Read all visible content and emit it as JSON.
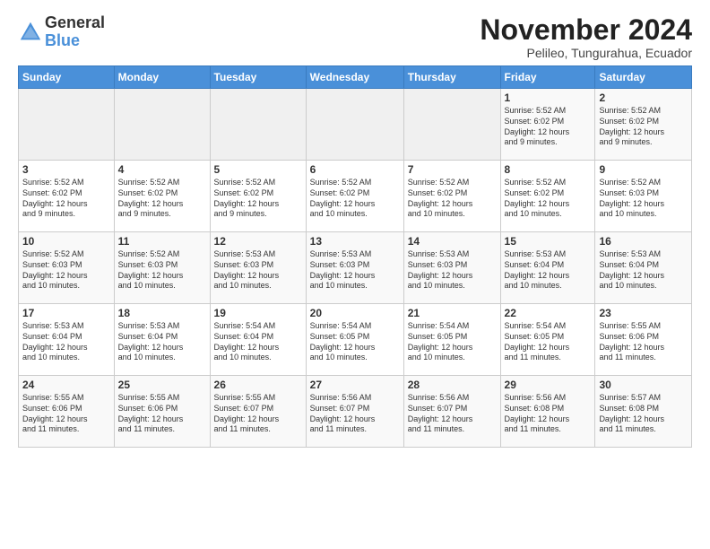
{
  "logo": {
    "general": "General",
    "blue": "Blue"
  },
  "title": "November 2024",
  "subtitle": "Pelileo, Tungurahua, Ecuador",
  "header": {
    "days": [
      "Sunday",
      "Monday",
      "Tuesday",
      "Wednesday",
      "Thursday",
      "Friday",
      "Saturday"
    ]
  },
  "weeks": [
    {
      "days": [
        {
          "num": "",
          "info": "",
          "empty": true
        },
        {
          "num": "",
          "info": "",
          "empty": true
        },
        {
          "num": "",
          "info": "",
          "empty": true
        },
        {
          "num": "",
          "info": "",
          "empty": true
        },
        {
          "num": "",
          "info": "",
          "empty": true
        },
        {
          "num": "1",
          "info": "Sunrise: 5:52 AM\nSunset: 6:02 PM\nDaylight: 12 hours\nand 9 minutes.",
          "empty": false
        },
        {
          "num": "2",
          "info": "Sunrise: 5:52 AM\nSunset: 6:02 PM\nDaylight: 12 hours\nand 9 minutes.",
          "empty": false
        }
      ]
    },
    {
      "days": [
        {
          "num": "3",
          "info": "Sunrise: 5:52 AM\nSunset: 6:02 PM\nDaylight: 12 hours\nand 9 minutes.",
          "empty": false
        },
        {
          "num": "4",
          "info": "Sunrise: 5:52 AM\nSunset: 6:02 PM\nDaylight: 12 hours\nand 9 minutes.",
          "empty": false
        },
        {
          "num": "5",
          "info": "Sunrise: 5:52 AM\nSunset: 6:02 PM\nDaylight: 12 hours\nand 9 minutes.",
          "empty": false
        },
        {
          "num": "6",
          "info": "Sunrise: 5:52 AM\nSunset: 6:02 PM\nDaylight: 12 hours\nand 10 minutes.",
          "empty": false
        },
        {
          "num": "7",
          "info": "Sunrise: 5:52 AM\nSunset: 6:02 PM\nDaylight: 12 hours\nand 10 minutes.",
          "empty": false
        },
        {
          "num": "8",
          "info": "Sunrise: 5:52 AM\nSunset: 6:02 PM\nDaylight: 12 hours\nand 10 minutes.",
          "empty": false
        },
        {
          "num": "9",
          "info": "Sunrise: 5:52 AM\nSunset: 6:03 PM\nDaylight: 12 hours\nand 10 minutes.",
          "empty": false
        }
      ]
    },
    {
      "days": [
        {
          "num": "10",
          "info": "Sunrise: 5:52 AM\nSunset: 6:03 PM\nDaylight: 12 hours\nand 10 minutes.",
          "empty": false
        },
        {
          "num": "11",
          "info": "Sunrise: 5:52 AM\nSunset: 6:03 PM\nDaylight: 12 hours\nand 10 minutes.",
          "empty": false
        },
        {
          "num": "12",
          "info": "Sunrise: 5:53 AM\nSunset: 6:03 PM\nDaylight: 12 hours\nand 10 minutes.",
          "empty": false
        },
        {
          "num": "13",
          "info": "Sunrise: 5:53 AM\nSunset: 6:03 PM\nDaylight: 12 hours\nand 10 minutes.",
          "empty": false
        },
        {
          "num": "14",
          "info": "Sunrise: 5:53 AM\nSunset: 6:03 PM\nDaylight: 12 hours\nand 10 minutes.",
          "empty": false
        },
        {
          "num": "15",
          "info": "Sunrise: 5:53 AM\nSunset: 6:04 PM\nDaylight: 12 hours\nand 10 minutes.",
          "empty": false
        },
        {
          "num": "16",
          "info": "Sunrise: 5:53 AM\nSunset: 6:04 PM\nDaylight: 12 hours\nand 10 minutes.",
          "empty": false
        }
      ]
    },
    {
      "days": [
        {
          "num": "17",
          "info": "Sunrise: 5:53 AM\nSunset: 6:04 PM\nDaylight: 12 hours\nand 10 minutes.",
          "empty": false
        },
        {
          "num": "18",
          "info": "Sunrise: 5:53 AM\nSunset: 6:04 PM\nDaylight: 12 hours\nand 10 minutes.",
          "empty": false
        },
        {
          "num": "19",
          "info": "Sunrise: 5:54 AM\nSunset: 6:04 PM\nDaylight: 12 hours\nand 10 minutes.",
          "empty": false
        },
        {
          "num": "20",
          "info": "Sunrise: 5:54 AM\nSunset: 6:05 PM\nDaylight: 12 hours\nand 10 minutes.",
          "empty": false
        },
        {
          "num": "21",
          "info": "Sunrise: 5:54 AM\nSunset: 6:05 PM\nDaylight: 12 hours\nand 10 minutes.",
          "empty": false
        },
        {
          "num": "22",
          "info": "Sunrise: 5:54 AM\nSunset: 6:05 PM\nDaylight: 12 hours\nand 11 minutes.",
          "empty": false
        },
        {
          "num": "23",
          "info": "Sunrise: 5:55 AM\nSunset: 6:06 PM\nDaylight: 12 hours\nand 11 minutes.",
          "empty": false
        }
      ]
    },
    {
      "days": [
        {
          "num": "24",
          "info": "Sunrise: 5:55 AM\nSunset: 6:06 PM\nDaylight: 12 hours\nand 11 minutes.",
          "empty": false
        },
        {
          "num": "25",
          "info": "Sunrise: 5:55 AM\nSunset: 6:06 PM\nDaylight: 12 hours\nand 11 minutes.",
          "empty": false
        },
        {
          "num": "26",
          "info": "Sunrise: 5:55 AM\nSunset: 6:07 PM\nDaylight: 12 hours\nand 11 minutes.",
          "empty": false
        },
        {
          "num": "27",
          "info": "Sunrise: 5:56 AM\nSunset: 6:07 PM\nDaylight: 12 hours\nand 11 minutes.",
          "empty": false
        },
        {
          "num": "28",
          "info": "Sunrise: 5:56 AM\nSunset: 6:07 PM\nDaylight: 12 hours\nand 11 minutes.",
          "empty": false
        },
        {
          "num": "29",
          "info": "Sunrise: 5:56 AM\nSunset: 6:08 PM\nDaylight: 12 hours\nand 11 minutes.",
          "empty": false
        },
        {
          "num": "30",
          "info": "Sunrise: 5:57 AM\nSunset: 6:08 PM\nDaylight: 12 hours\nand 11 minutes.",
          "empty": false
        }
      ]
    }
  ]
}
